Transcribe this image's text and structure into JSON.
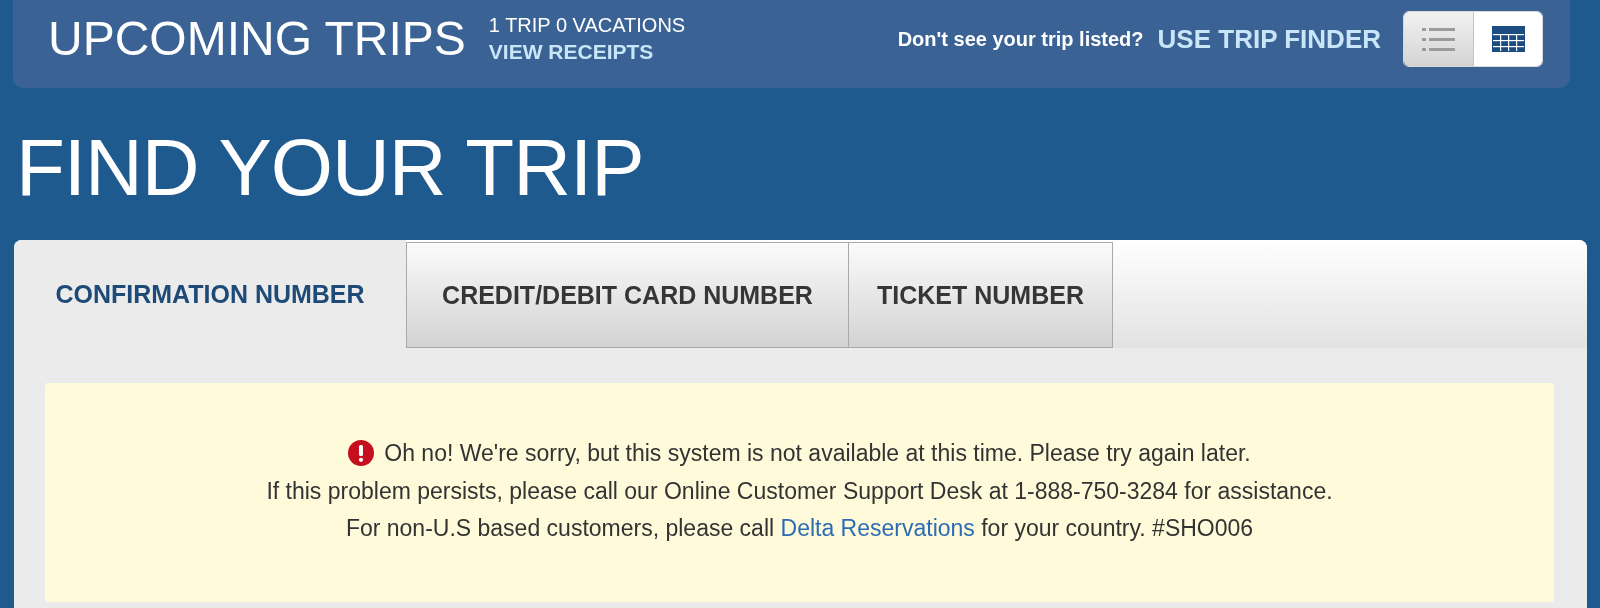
{
  "header": {
    "title": "UPCOMING TRIPS",
    "counts": "1 TRIP 0 VACATIONS",
    "receipts_link": "VIEW RECEIPTS",
    "prompt": "Don't see your trip listed?",
    "finder_link": "USE TRIP FINDER",
    "view_toggle": [
      {
        "kind": "list",
        "selected": false
      },
      {
        "kind": "grid",
        "selected": true
      }
    ]
  },
  "page_title": "FIND YOUR TRIP",
  "tabs": [
    {
      "label": "CONFIRMATION NUMBER",
      "selected": true
    },
    {
      "label": "CREDIT/DEBIT CARD NUMBER",
      "selected": false
    },
    {
      "label": "TICKET NUMBER",
      "selected": false
    }
  ],
  "alert": {
    "kind": "error",
    "lines": [
      {
        "parts": [
          {
            "kind": "text",
            "text": "Oh no! We're sorry, but this system is not available at this time. Please try again later."
          }
        ]
      },
      {
        "parts": [
          {
            "kind": "text",
            "text": "If this problem persists, please call our Online Customer Support Desk at 1-888-750-3284 for assistance."
          }
        ]
      },
      {
        "parts": [
          {
            "kind": "text",
            "text": "For non-U.S based customers, please call "
          },
          {
            "kind": "link",
            "text": "Delta Reservations"
          },
          {
            "kind": "text",
            "text": " for your country. #SHO006"
          }
        ]
      }
    ]
  }
}
